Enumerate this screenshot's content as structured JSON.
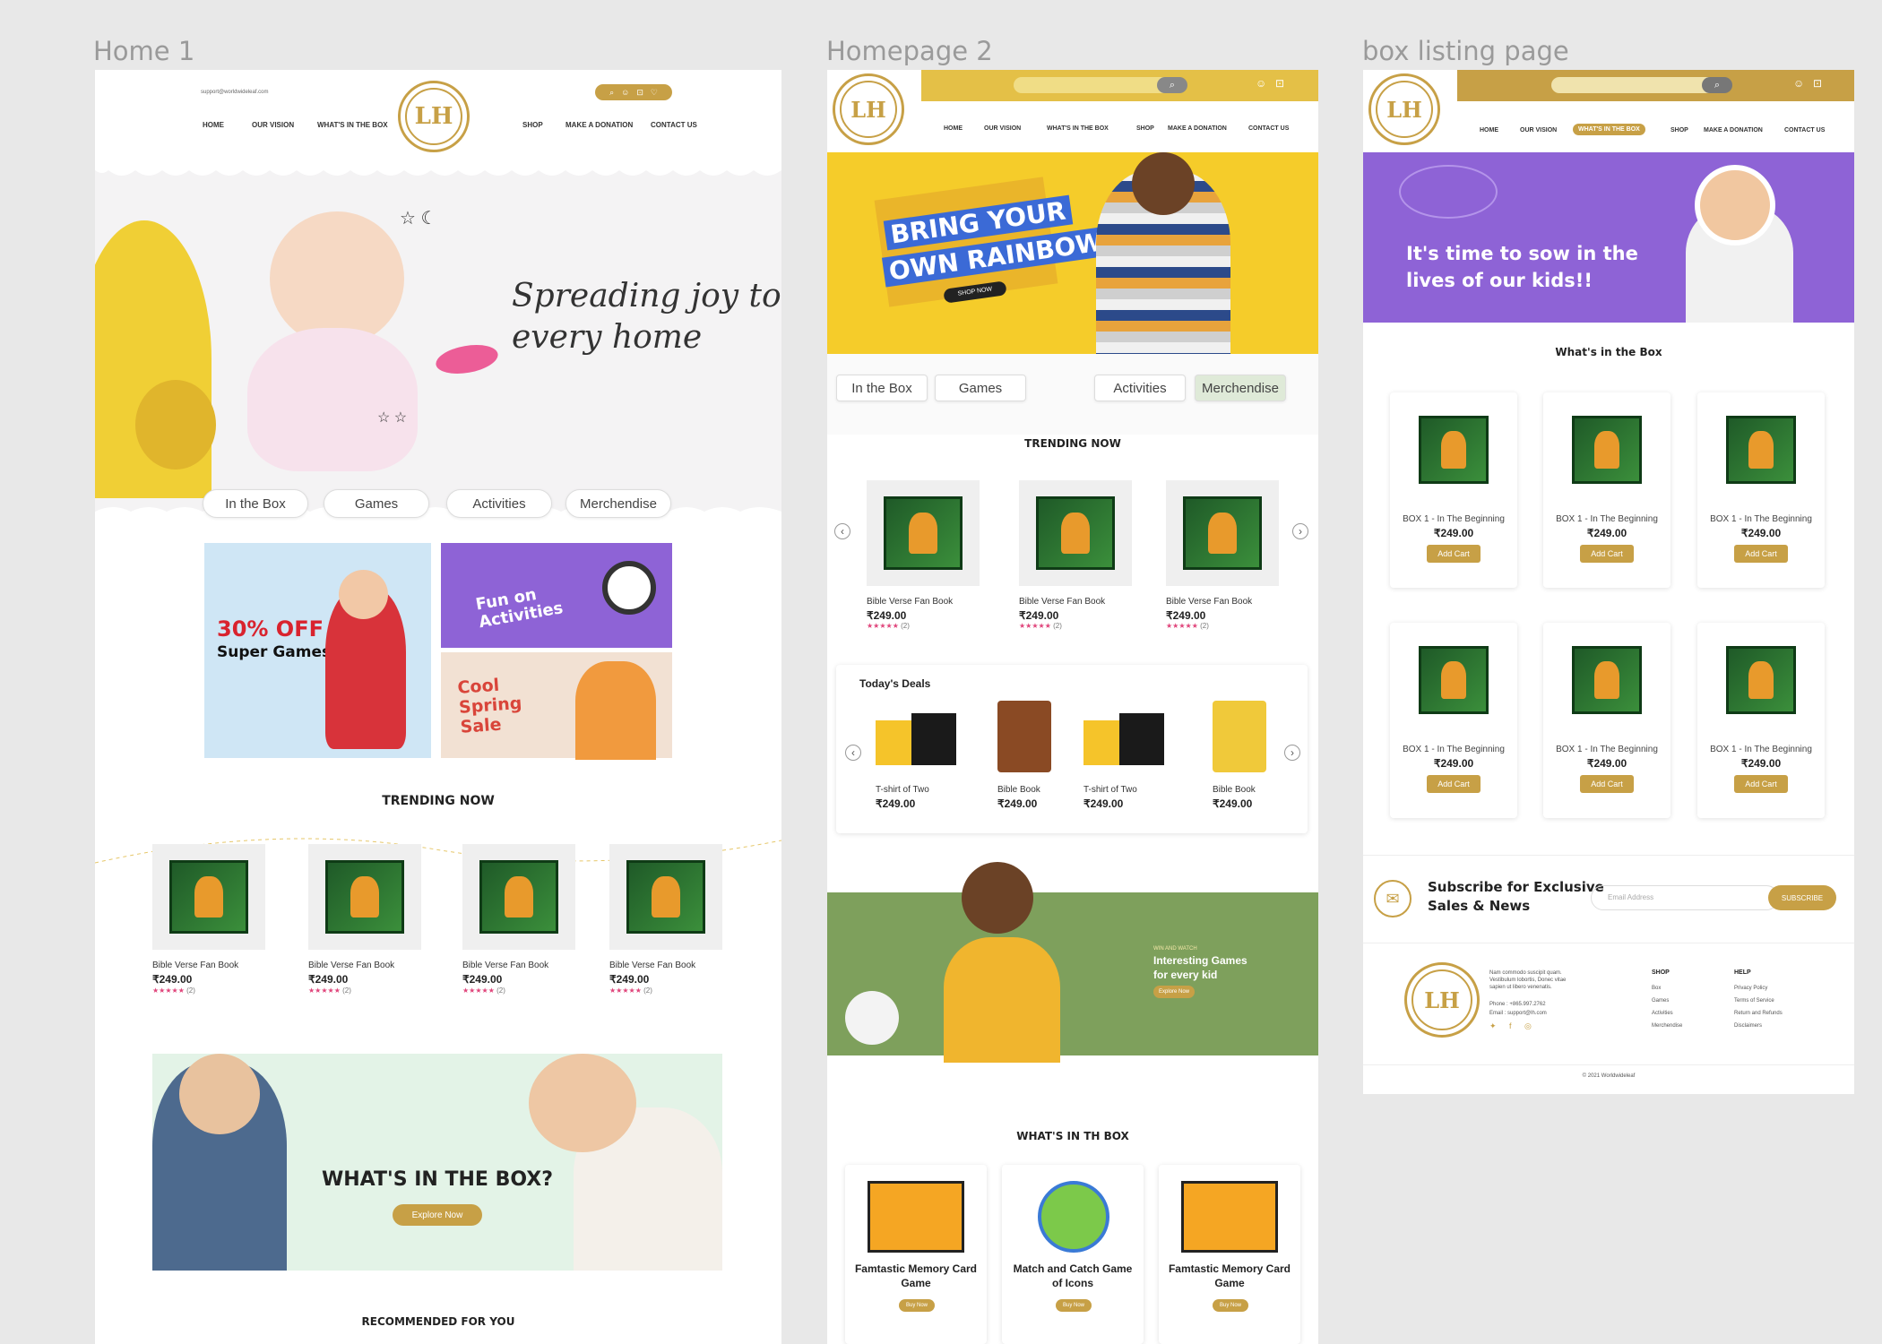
{
  "frames": {
    "home1": "Home 1",
    "home2": "Homepage 2",
    "listing": "box listing page"
  },
  "home1": {
    "support": "support@worldwideleaf.com",
    "logo": "LH",
    "nav": [
      "HOME",
      "OUR VISION",
      "WHAT'S IN THE BOX",
      "SHOP",
      "MAKE A DONATION",
      "CONTACT US"
    ],
    "hero_line1": "Spreading joy to",
    "hero_line2": "every home",
    "categories": [
      "In the Box",
      "Games",
      "Activities",
      "Merchendise"
    ],
    "promo1_a": "30% OFF",
    "promo1_b": "Super Games",
    "promo2": "Fun on Activities",
    "promo3": "Cool Spring Sale",
    "trending_title": "TRENDING NOW",
    "products": [
      {
        "name": "Bible Verse Fan Book",
        "price": "₹249.00",
        "stars": "★★★★★",
        "count": "(2)"
      },
      {
        "name": "Bible Verse Fan Book",
        "price": "₹249.00",
        "stars": "★★★★★",
        "count": "(2)"
      },
      {
        "name": "Bible Verse Fan Book",
        "price": "₹249.00",
        "stars": "★★★★★",
        "count": "(2)"
      },
      {
        "name": "Bible Verse Fan Book",
        "price": "₹249.00",
        "stars": "★★★★★",
        "count": "(2)"
      }
    ],
    "box_banner_title": "WHAT'S IN THE BOX?",
    "explore": "Explore Now",
    "recommended": "RECOMMENDED FOR YOU"
  },
  "home2": {
    "logo": "LH",
    "nav": [
      "HOME",
      "OUR VISION",
      "WHAT'S IN THE BOX",
      "SHOP",
      "MAKE A DONATION",
      "CONTACT US"
    ],
    "hero_line1": "BRING YOUR",
    "hero_line2": "OWN RAINBOW",
    "hero_btn": "SHOP NOW",
    "categories": [
      "In the Box",
      "Games",
      "Activities",
      "Merchendise"
    ],
    "trending_title": "TRENDING NOW",
    "products": [
      {
        "name": "Bible Verse Fan Book",
        "price": "₹249.00",
        "stars": "★★★★★",
        "count": "(2)"
      },
      {
        "name": "Bible Verse Fan Book",
        "price": "₹249.00",
        "stars": "★★★★★",
        "count": "(2)"
      },
      {
        "name": "Bible Verse Fan Book",
        "price": "₹249.00",
        "stars": "★★★★★",
        "count": "(2)"
      }
    ],
    "deals_title": "Today's Deals",
    "deals": [
      {
        "name": "T-shirt of Two",
        "price": "₹249.00"
      },
      {
        "name": "Bible Book",
        "price": "₹249.00"
      },
      {
        "name": "T-shirt of Two",
        "price": "₹249.00"
      },
      {
        "name": "Bible Book",
        "price": "₹249.00"
      }
    ],
    "games_kicker": "WIN AND WATCH",
    "games_title": "Interesting Games for every kid",
    "games_btn": "Explore Now",
    "box_title": "WHAT'S IN TH BOX",
    "box_items": [
      {
        "name": "Famtastic Memory Card Game",
        "btn": "Buy Now"
      },
      {
        "name": "Match and Catch Game of Icons",
        "btn": "Buy Now"
      },
      {
        "name": "Famtastic Memory Card Game",
        "btn": "Buy Now"
      }
    ]
  },
  "listing": {
    "logo": "LH",
    "nav": [
      "HOME",
      "OUR VISION",
      "WHAT'S IN THE BOX",
      "SHOP",
      "MAKE A DONATION",
      "CONTACT US"
    ],
    "hero_line1": "It's time to sow in the",
    "hero_line2": "lives of our kids!!",
    "section_title": "What's in the Box",
    "items": [
      {
        "name": "BOX 1 - In The Beginning",
        "price": "₹249.00",
        "btn": "Add Cart"
      },
      {
        "name": "BOX 1 - In The Beginning",
        "price": "₹249.00",
        "btn": "Add Cart"
      },
      {
        "name": "BOX 1 - In The Beginning",
        "price": "₹249.00",
        "btn": "Add Cart"
      },
      {
        "name": "BOX 1 - In The Beginning",
        "price": "₹249.00",
        "btn": "Add Cart"
      },
      {
        "name": "BOX 1 - In The Beginning",
        "price": "₹249.00",
        "btn": "Add Cart"
      },
      {
        "name": "BOX 1 - In The Beginning",
        "price": "₹249.00",
        "btn": "Add Cart"
      }
    ],
    "subscribe_line1": "Subscribe for Exclusive",
    "subscribe_line2": "Sales & News",
    "email_placeholder": "Email Address",
    "subscribe_btn": "SUBSCRIBE",
    "footer_text": "Nam commodo suscipit quam. Vestibulum lobortis, Donec vitae sapien ut libero venenatis.",
    "phone": "Phone : +865.997.2762",
    "email": "Email : support@lh.com",
    "shop_title": "SHOP",
    "shop_links": [
      "Box",
      "Games",
      "Activities",
      "Merchendise"
    ],
    "help_title": "HELP",
    "help_links": [
      "Privacy Policy",
      "Terms of Service",
      "Return and Refunds",
      "Disclaimers"
    ],
    "copyright": "© 2021 Worldwideleaf"
  },
  "colors": {
    "gold": "#c7a046",
    "purple": "#8e63d6",
    "yellow": "#f5cc2a",
    "green": "#7ea05c",
    "pink": "#e0457b"
  }
}
